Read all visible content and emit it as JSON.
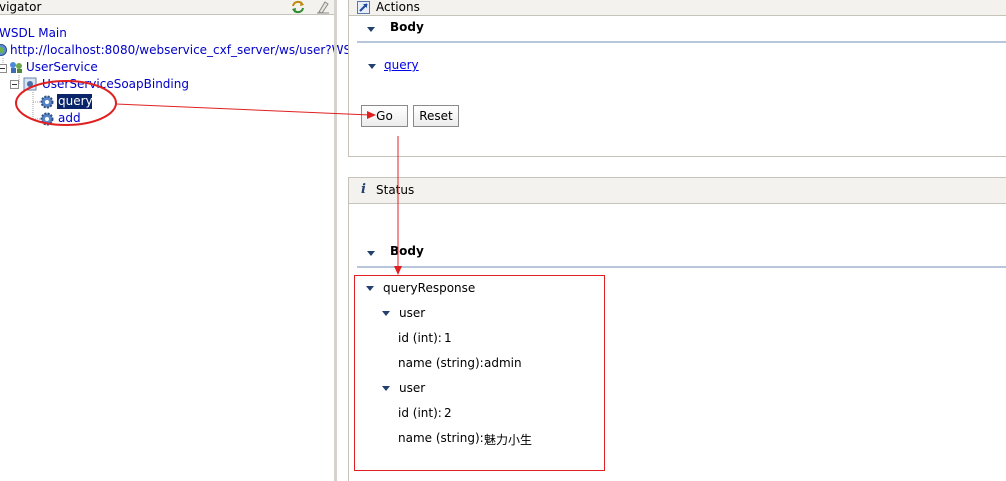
{
  "navigator": {
    "title": "vigator",
    "sync_icon": "sync-icon",
    "clear_icon": "eraser-icon",
    "tree": {
      "root": "WSDL Main",
      "url": "http://localhost:8080/webservice_cxf_server/ws/user?WS",
      "service": "UserService",
      "binding": "UserServiceSoapBinding",
      "operations": [
        "query",
        "add"
      ]
    }
  },
  "actions": {
    "title": "Actions",
    "body_label": "Body",
    "operation_link": "query",
    "go_label": "Go",
    "reset_label": "Reset"
  },
  "status": {
    "title": "Status",
    "body_label": "Body",
    "response": {
      "name": "queryResponse",
      "users": [
        {
          "label": "user",
          "id_label": "id (int):",
          "id": "1",
          "name_label": "name (string):",
          "name": "admin"
        },
        {
          "label": "user",
          "id_label": "id (int):",
          "id": "2",
          "name_label": "name (string):",
          "name": "魅力小生"
        }
      ]
    }
  },
  "colors": {
    "link": "#0000c8",
    "selection": "#0a246a",
    "annotation": "#e02020",
    "header": "#f3f2ee"
  }
}
